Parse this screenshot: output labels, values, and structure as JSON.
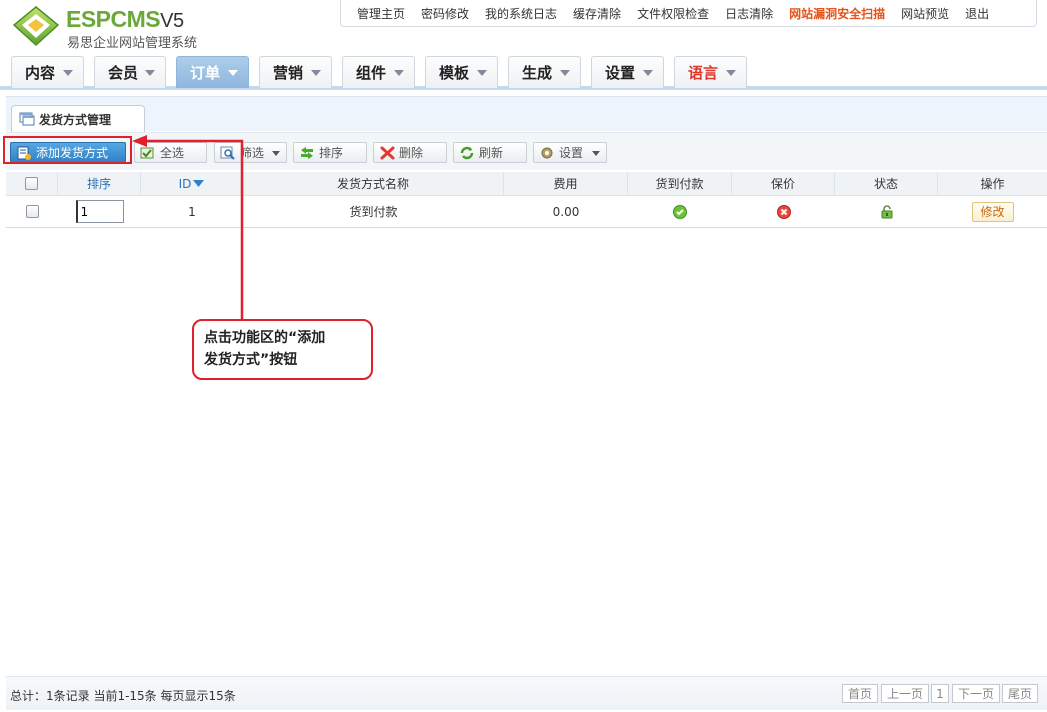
{
  "logo": {
    "brand": "ESPCMS",
    "version": "V5",
    "subtitle": "易思企业网站管理系统"
  },
  "top_nav": [
    "管理主页",
    "密码修改",
    "我的系统日志",
    "缓存清除",
    "文件权限检查",
    "日志清除",
    "网站漏洞安全扫描",
    "网站预览",
    "退出"
  ],
  "menu": {
    "tabs": [
      "内容",
      "会员",
      "订单",
      "营销",
      "组件",
      "模板",
      "生成",
      "设置",
      "语言"
    ],
    "active": "订单"
  },
  "page_tab": "发货方式管理",
  "toolbar": {
    "add": "添加发货方式",
    "select_all": "全选",
    "filter": "筛选",
    "sort": "排序",
    "delete": "删除",
    "refresh": "刷新",
    "settings": "设置"
  },
  "table": {
    "headers": {
      "sort": "排序",
      "id": "ID",
      "name": "发货方式名称",
      "fee": "费用",
      "cod": "货到付款",
      "insured": "保价",
      "status": "状态",
      "action": "操作"
    },
    "rows": [
      {
        "sort": "1",
        "id": "1",
        "name": "货到付款",
        "fee": "0.00",
        "cod": "yes",
        "insured": "no",
        "status": "unlocked",
        "action": "修改"
      }
    ]
  },
  "annotation": {
    "line1": "点击功能区的“添加",
    "line2": "发货方式”按钮"
  },
  "footer": {
    "info": "总计：1条记录 当前1-15条 每页显示15条",
    "pager": {
      "first": "首页",
      "prev": "上一页",
      "current": "1",
      "next": "下一页",
      "last": "尾页"
    }
  },
  "colors": {
    "accent": "#2f82c7",
    "highlight": "#e0202a",
    "logo_green": "#6aa83a",
    "hot_link": "#e5521a"
  }
}
